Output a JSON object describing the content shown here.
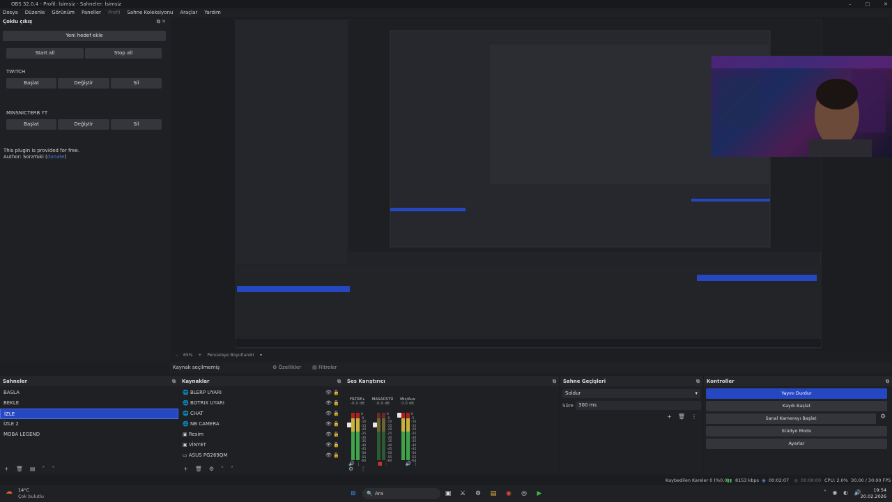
{
  "window": {
    "title": "OBS 32.0.4 - Profil: İsimsiz - Sahneler: İsimsiz",
    "controls": [
      "–",
      "□",
      "✕"
    ]
  },
  "menu": [
    "Dosya",
    "Düzenle",
    "Görünüm",
    "Paneller",
    "Profil",
    "Sahne Koleksiyonu",
    "Araçlar",
    "Yardım"
  ],
  "multi_output": {
    "title": "Çoklu çıkış",
    "add_target": "Yeni hedef ekle",
    "start_all": "Start all",
    "stop_all": "Stop all",
    "targets": [
      {
        "name": "TWITCH",
        "start": "Başlat",
        "edit": "Değiştir",
        "delete": "Sil"
      },
      {
        "name": "MINSNICTERB YT",
        "start": "Başlat",
        "edit": "Değiştir",
        "delete": "Sil"
      }
    ],
    "footer_line1": "This plugin is provided for free.",
    "footer_author": "Author: SoraYuki (",
    "footer_link": "donate",
    "footer_close": ")"
  },
  "preview_bar": {
    "zoom": "65%",
    "mode": "Pencereye Boyutlandır"
  },
  "source_bar": {
    "none_selected": "Kaynak seçilmemiş",
    "properties": "Özellikler",
    "filters": "Filtreler"
  },
  "scenes": {
    "title": "Sahneler",
    "items": [
      "BASLA",
      "BEKLE",
      "İZLE",
      "İZLE 2",
      "MOBA LEGEND"
    ],
    "selected_index": 2
  },
  "sources": {
    "title": "Kaynaklar",
    "items": [
      {
        "label": "BLERP UYARI",
        "icon": "browser-icon"
      },
      {
        "label": "BOTRIX UYARI",
        "icon": "browser-icon"
      },
      {
        "label": "CHAT",
        "icon": "browser-icon"
      },
      {
        "label": "NB CAMERA",
        "icon": "browser-icon"
      },
      {
        "label": "Resim",
        "icon": "image-icon"
      },
      {
        "label": "VİNYET",
        "icon": "image-icon"
      },
      {
        "label": "ASUS PG269QM",
        "icon": "monitor-icon"
      }
    ]
  },
  "mixer": {
    "title": "Ses Karıştırıcı",
    "channels": [
      {
        "name": "FİLTRE+",
        "db": "-6.0 dB",
        "level": 0.55
      },
      {
        "name": "MASAÜSTÜ",
        "db": "-6.9 dB",
        "level": 0.55
      },
      {
        "name": "Mic/Aux",
        "db": "0.0 dB",
        "level": 0.0
      }
    ],
    "scale": [
      "0",
      "-5",
      "-10",
      "-15",
      "-20",
      "-25",
      "-30",
      "-35",
      "-40",
      "-45",
      "-50",
      "-55",
      "-60"
    ]
  },
  "transitions": {
    "title": "Sahne Geçişleri",
    "type": "Soldur",
    "duration_label": "Süre",
    "duration": "300 ms"
  },
  "controls": {
    "title": "Kontroller",
    "buttons": [
      "Yayını Durdur",
      "Kaydı Başlat",
      "Sanal Kamerayı Başlat",
      "Stüdyo Modu",
      "Ayarlar"
    ]
  },
  "status": {
    "dropped": "Kaybedilen Kareler 0 (%0.0)",
    "bitrate": "8153 kbps",
    "stream_time": "00:02:07",
    "rec_time": "00:00:00",
    "cpu": "CPU: 2.0%",
    "fps": "30.00 / 30.00 FPS"
  },
  "taskbar": {
    "weather_temp": "14°C",
    "weather_desc": "Çok bulutlu",
    "search": "Ara",
    "time": "19:54",
    "date": "20.02.2026"
  },
  "colors": {
    "accent": "#2547c2",
    "bg": "#1d1e22",
    "panel": "#1f2024",
    "live": "#3fb64a"
  }
}
